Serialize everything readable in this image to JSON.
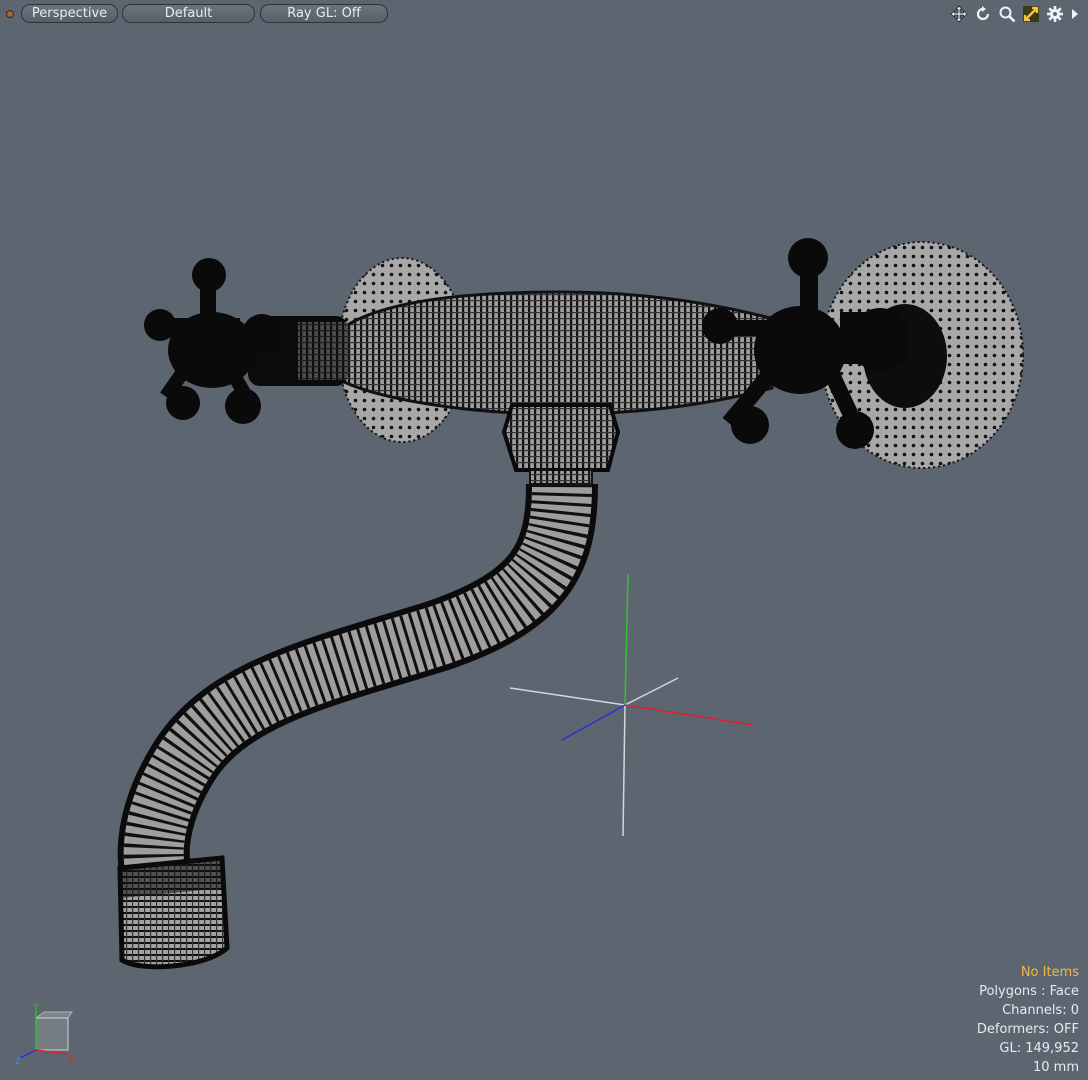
{
  "toolbar": {
    "view_mode": "Perspective",
    "shading": "Default",
    "ray_gl": "Ray GL: Off",
    "icons": [
      "move-view-icon",
      "rotate-view-icon",
      "zoom-view-icon",
      "fit-view-icon",
      "settings-gear-icon",
      "expand-arrow-icon"
    ]
  },
  "status": {
    "items": "No Items",
    "polygons": "Polygons : Face",
    "channels": "Channels: 0",
    "deformers": "Deformers: OFF",
    "gl": "GL: 149,952",
    "scale": "10 mm"
  },
  "gizmo": {
    "y": "Y",
    "z": "Z",
    "x": "X"
  },
  "colors": {
    "background": "#5d6670",
    "mesh": "#0a0a0a",
    "highlight": "#f2b84a",
    "axis_x": "#d9242f",
    "axis_y": "#32c22f",
    "axis_z": "#2330d6",
    "axis_grey": "#dcdcdc"
  }
}
